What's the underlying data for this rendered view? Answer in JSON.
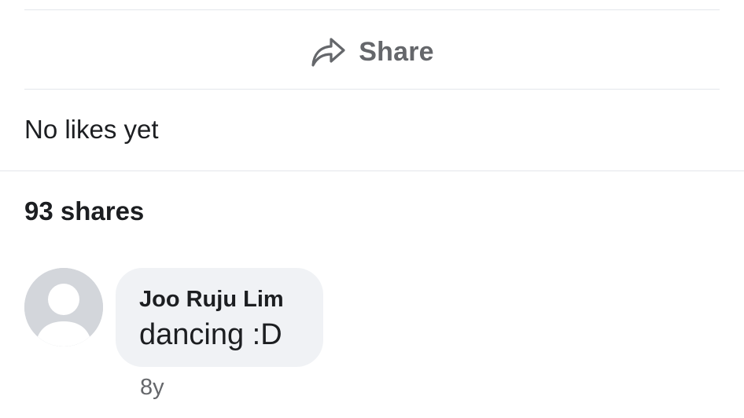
{
  "share": {
    "label": "Share"
  },
  "likes": {
    "text": "No likes yet"
  },
  "shares": {
    "count_text": "93 shares"
  },
  "comment": {
    "author": "Joo Ruju Lim",
    "text": "dancing :D",
    "timestamp": "8y"
  }
}
